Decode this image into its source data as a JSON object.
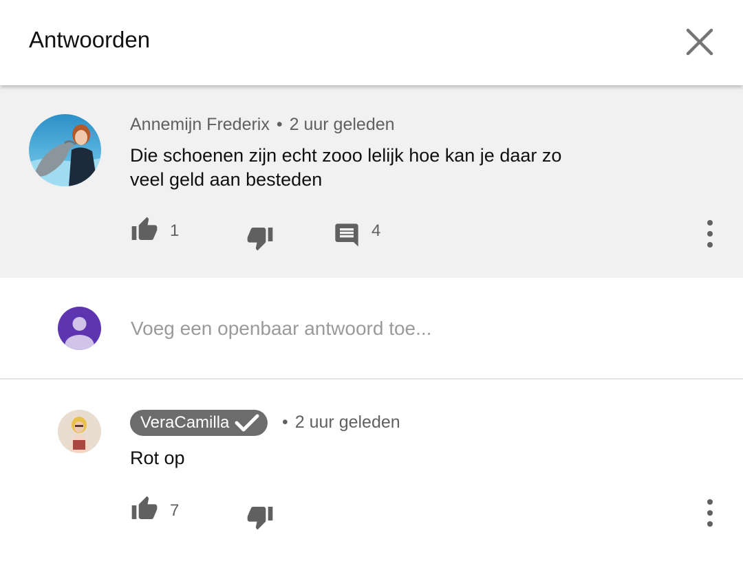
{
  "header": {
    "title": "Antwoorden"
  },
  "main_comment": {
    "author": "Annemijn Frederix",
    "separator": "•",
    "time": "2 uur geleden",
    "text_line1": "Die schoenen zijn echt zooo lelijk hoe kan je daar zo",
    "text_line2": "veel geld aan besteden",
    "likes": "1",
    "replies": "4"
  },
  "reply_input": {
    "placeholder": "Voeg een openbaar antwoord toe..."
  },
  "replies": [
    {
      "author": "VeraCamilla",
      "verified": true,
      "separator": "•",
      "time": "2 uur geleden",
      "text": "Rot op",
      "likes": "7"
    }
  ],
  "colors": {
    "comment_bg": "#f1f1f1",
    "icon_gray": "#606060",
    "user_avatar": "#5e35b1",
    "author_chip": "#6c6c6c"
  },
  "icons": [
    "close-icon",
    "thumb-up-icon",
    "thumb-down-icon",
    "comment-icon",
    "more-vert-icon",
    "check-icon",
    "person-icon"
  ]
}
